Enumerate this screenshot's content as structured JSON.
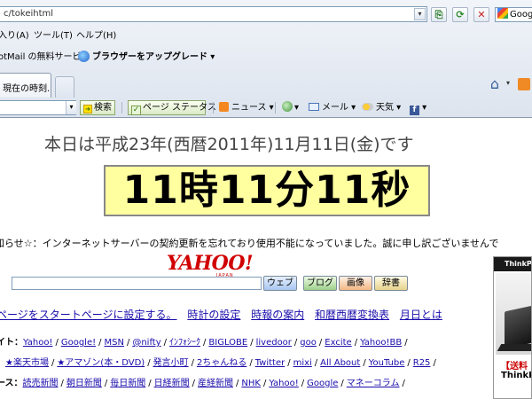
{
  "browser": {
    "address": "c/tokeihtml",
    "search_provider": "Googl",
    "menu": [
      "入り(A)",
      "ツール(T)",
      "ヘルプ(H)"
    ],
    "favorites": [
      {
        "label": "otMail の無料サービス"
      },
      {
        "label": "ブラウザーをアップグレード",
        "arrow": "▾"
      }
    ],
    "tab_label": "現在の時刻..",
    "search_toolbar": {
      "search_label": "検索",
      "page_status_label": "ページ ステータス",
      "news_label": "ニュース",
      "mail_label": "メール",
      "weather_label": "天気"
    }
  },
  "page": {
    "date_line": "本日は平成23年(西暦2011年)11月11日(金)です",
    "clock": "11時11分11秒",
    "notice": "知らせ☆：インターネットサーバーの契約更新を忘れており使用不能になっていました。誠に申し訳ございませんで",
    "yahoo": {
      "logo": "YAHOO!",
      "logo_sub": "JAPAN",
      "buttons": {
        "web": "ウェブ",
        "blog": "ブログ",
        "image": "画像",
        "dict": "辞書"
      }
    },
    "nav_links": [
      "ページをスタートページに設定する。",
      "時計の設定",
      "時報の案内",
      "和暦西暦変換表",
      "月日とは"
    ],
    "link_rows": [
      {
        "label": "イト：",
        "links": [
          "Yahoo!",
          "Google!",
          "MSN",
          "@nifty",
          "ｲﾝﾌｫｼｰｸ",
          "BIGLOBE",
          "livedoor",
          "goo",
          "Excite",
          "Yahoo!BB"
        ]
      },
      {
        "label": "：",
        "links": [
          "★楽天市場",
          "★アマゾン(本・DVD)",
          "発言小町",
          "2ちゃんねる",
          "Twitter",
          "mixi",
          "All About",
          "YouTube",
          "R25"
        ]
      },
      {
        "label": "ース：",
        "links": [
          "読売新聞",
          "朝日新聞",
          "毎日新聞",
          "日経新聞",
          "産経新聞",
          "NHK",
          "Yahoo!",
          "Google",
          "マネーコラム"
        ]
      }
    ],
    "ad": {
      "brand": "ThinkPad",
      "line1": "【送料",
      "line2": "ThinkPa"
    }
  }
}
